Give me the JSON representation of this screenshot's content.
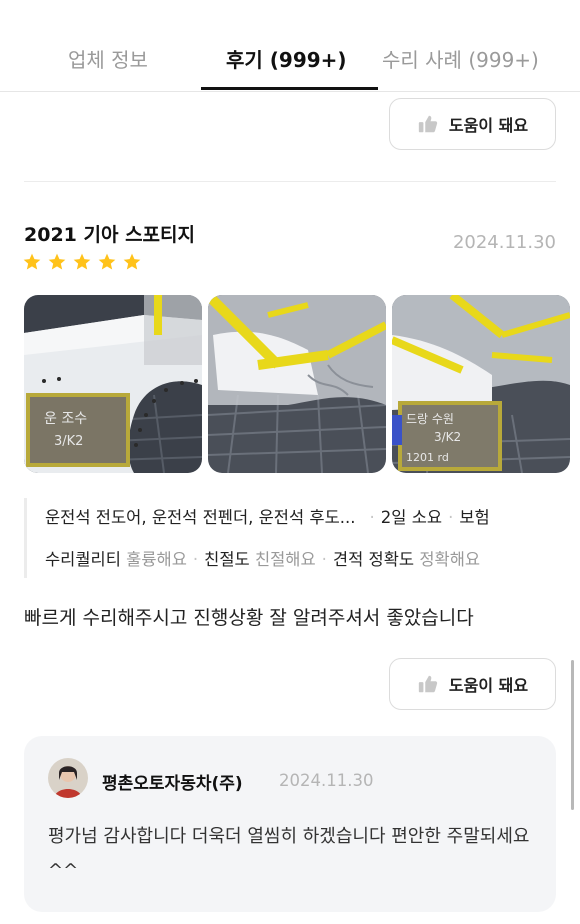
{
  "tabs": [
    {
      "label": "업체 정보"
    },
    {
      "label": "후기 (999+)"
    },
    {
      "label": "수리 사례 (999+)"
    }
  ],
  "helpful_label": "도움이 돼요",
  "review": {
    "car": "2021 기아 스포티지",
    "date": "2024.11.30",
    "rating": 5,
    "repair_parts": "운전석 전도어, 운전석 전펜더, 운전석 후도...",
    "duration": "2일 소요",
    "insurance": "보험",
    "quality_label": "수리퀄리티",
    "quality_value": "훌륭해요",
    "kindness_label": "친절도",
    "kindness_value": "친절해요",
    "accuracy_label": "견적 정확도",
    "accuracy_value": "정확해요",
    "text": "빠르게 수리해주시고 진행상황 잘 알려주셔서 좋았습니다"
  },
  "reply": {
    "shop_name": "평촌오토자동차(주)",
    "date": "2024.11.30",
    "text": "평가넘 감사합니다 더욱더 열씸히 하겠습니다 편안한 주말되세요^^"
  },
  "colors": {
    "star": "#ffc21a",
    "tape": "#e8d81a",
    "muted": "#9a9a9a"
  }
}
